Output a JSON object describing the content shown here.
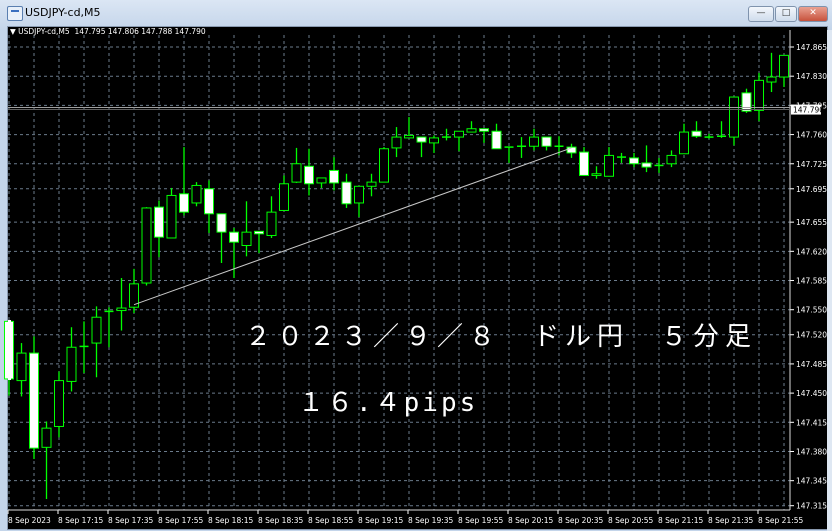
{
  "window": {
    "title": "USDJPY-cd,M5",
    "buttons": {
      "minimize": "—",
      "maximize": "□",
      "close": "✕"
    }
  },
  "chart_header": {
    "symbol": "USDJPY-cd,M5",
    "ohlc_text": "147.795 147.806 147.788 147.790"
  },
  "annotations": {
    "title_text": "２０２３／９／８　ドル円　５分足",
    "pips_text": "１６.４pips"
  },
  "chart_data": {
    "type": "candlestick",
    "symbol": "USDJPY-cd",
    "timeframe": "M5",
    "ylim": [
      147.315,
      147.87
    ],
    "grid": true,
    "colors": {
      "bull_outline": "#00ff00",
      "bull_fill": "#000000",
      "bear_fill": "#ffffff",
      "wick": "#00ff00",
      "grid": "#6b7b8c",
      "background": "#000000",
      "trendline": "#c8c8c8",
      "bid_line": "#a0a0a0"
    },
    "bid_price": "147.790",
    "y_ticks": [
      "147.865",
      "147.830",
      "147.795",
      "147.760",
      "147.725",
      "147.695",
      "147.655",
      "147.620",
      "147.585",
      "147.550",
      "147.520",
      "147.485",
      "147.450",
      "147.415",
      "147.380",
      "147.345",
      "147.315"
    ],
    "x_ticks": [
      "8 Sep 2023",
      "8 Sep 17:15",
      "8 Sep 17:35",
      "8 Sep 17:55",
      "8 Sep 18:15",
      "8 Sep 18:35",
      "8 Sep 18:55",
      "8 Sep 19:15",
      "8 Sep 19:35",
      "8 Sep 19:55",
      "8 Sep 20:15",
      "8 Sep 20:35",
      "8 Sep 20:55",
      "8 Sep 21:15",
      "8 Sep 21:35",
      "8 Sep 21:55"
    ],
    "trendline": {
      "from": {
        "time": "17:45",
        "price": 147.556
      },
      "to": {
        "time": "20:40",
        "price": 147.744
      }
    },
    "candles": [
      {
        "t": "16:55",
        "o": 147.536,
        "h": 147.537,
        "l": 147.447,
        "c": 147.467
      },
      {
        "t": "17:00",
        "o": 147.465,
        "h": 147.51,
        "l": 147.446,
        "c": 147.498
      },
      {
        "t": "17:05",
        "o": 147.498,
        "h": 147.518,
        "l": 147.371,
        "c": 147.384
      },
      {
        "t": "17:10",
        "o": 147.385,
        "h": 147.416,
        "l": 147.323,
        "c": 147.408
      },
      {
        "t": "17:15",
        "o": 147.41,
        "h": 147.476,
        "l": 147.397,
        "c": 147.465
      },
      {
        "t": "17:20",
        "o": 147.464,
        "h": 147.529,
        "l": 147.452,
        "c": 147.505
      },
      {
        "t": "17:25",
        "o": 147.506,
        "h": 147.536,
        "l": 147.474,
        "c": 147.506
      },
      {
        "t": "17:30",
        "o": 147.51,
        "h": 147.554,
        "l": 147.469,
        "c": 147.541
      },
      {
        "t": "17:35",
        "o": 147.548,
        "h": 147.553,
        "l": 147.505,
        "c": 147.548
      },
      {
        "t": "17:40",
        "o": 147.549,
        "h": 147.588,
        "l": 147.525,
        "c": 147.552
      },
      {
        "t": "17:45",
        "o": 147.553,
        "h": 147.599,
        "l": 147.546,
        "c": 147.581
      },
      {
        "t": "17:50",
        "o": 147.582,
        "h": 147.673,
        "l": 147.579,
        "c": 147.672
      },
      {
        "t": "17:55",
        "o": 147.673,
        "h": 147.681,
        "l": 147.613,
        "c": 147.637
      },
      {
        "t": "18:00",
        "o": 147.636,
        "h": 147.696,
        "l": 147.636,
        "c": 147.687
      },
      {
        "t": "18:05",
        "o": 147.689,
        "h": 147.745,
        "l": 147.663,
        "c": 147.667
      },
      {
        "t": "18:10",
        "o": 147.678,
        "h": 147.703,
        "l": 147.674,
        "c": 147.699
      },
      {
        "t": "18:15",
        "o": 147.695,
        "h": 147.705,
        "l": 147.642,
        "c": 147.665
      },
      {
        "t": "18:20",
        "o": 147.665,
        "h": 147.665,
        "l": 147.606,
        "c": 147.643
      },
      {
        "t": "18:25",
        "o": 147.643,
        "h": 147.648,
        "l": 147.588,
        "c": 147.631
      },
      {
        "t": "18:30",
        "o": 147.627,
        "h": 147.68,
        "l": 147.614,
        "c": 147.643
      },
      {
        "t": "18:35",
        "o": 147.644,
        "h": 147.644,
        "l": 147.618,
        "c": 147.641
      },
      {
        "t": "18:40",
        "o": 147.639,
        "h": 147.686,
        "l": 147.636,
        "c": 147.667
      },
      {
        "t": "18:45",
        "o": 147.669,
        "h": 147.711,
        "l": 147.669,
        "c": 147.701
      },
      {
        "t": "18:50",
        "o": 147.703,
        "h": 147.744,
        "l": 147.702,
        "c": 147.725
      },
      {
        "t": "18:55",
        "o": 147.722,
        "h": 147.743,
        "l": 147.687,
        "c": 147.701
      },
      {
        "t": "19:00",
        "o": 147.702,
        "h": 147.708,
        "l": 147.696,
        "c": 147.708
      },
      {
        "t": "19:05",
        "o": 147.717,
        "h": 147.733,
        "l": 147.693,
        "c": 147.702
      },
      {
        "t": "19:10",
        "o": 147.703,
        "h": 147.713,
        "l": 147.672,
        "c": 147.677
      },
      {
        "t": "19:15",
        "o": 147.678,
        "h": 147.698,
        "l": 147.661,
        "c": 147.698
      },
      {
        "t": "19:20",
        "o": 147.698,
        "h": 147.713,
        "l": 147.686,
        "c": 147.703
      },
      {
        "t": "19:25",
        "o": 147.703,
        "h": 147.745,
        "l": 147.703,
        "c": 147.743
      },
      {
        "t": "19:30",
        "o": 147.744,
        "h": 147.769,
        "l": 147.733,
        "c": 147.757
      },
      {
        "t": "19:35",
        "o": 147.756,
        "h": 147.781,
        "l": 147.756,
        "c": 147.759
      },
      {
        "t": "19:40",
        "o": 147.757,
        "h": 147.757,
        "l": 147.733,
        "c": 147.751
      },
      {
        "t": "19:45",
        "o": 147.75,
        "h": 147.759,
        "l": 147.738,
        "c": 147.756
      },
      {
        "t": "19:50",
        "o": 147.756,
        "h": 147.767,
        "l": 147.753,
        "c": 147.757
      },
      {
        "t": "19:55",
        "o": 147.757,
        "h": 147.764,
        "l": 147.74,
        "c": 147.764
      },
      {
        "t": "20:00",
        "o": 147.763,
        "h": 147.776,
        "l": 147.763,
        "c": 147.767
      },
      {
        "t": "20:05",
        "o": 147.767,
        "h": 147.767,
        "l": 147.75,
        "c": 147.764
      },
      {
        "t": "20:10",
        "o": 147.764,
        "h": 147.773,
        "l": 147.743,
        "c": 147.743
      },
      {
        "t": "20:15",
        "o": 147.745,
        "h": 147.745,
        "l": 147.726,
        "c": 147.745
      },
      {
        "t": "20:20",
        "o": 147.746,
        "h": 147.757,
        "l": 147.732,
        "c": 147.746
      },
      {
        "t": "20:25",
        "o": 147.746,
        "h": 147.767,
        "l": 147.741,
        "c": 147.757
      },
      {
        "t": "20:30",
        "o": 147.757,
        "h": 147.757,
        "l": 147.741,
        "c": 147.746
      },
      {
        "t": "20:35",
        "o": 147.746,
        "h": 147.758,
        "l": 147.735,
        "c": 147.746
      },
      {
        "t": "20:40",
        "o": 147.745,
        "h": 147.749,
        "l": 147.732,
        "c": 147.738
      },
      {
        "t": "20:45",
        "o": 147.739,
        "h": 147.745,
        "l": 147.711,
        "c": 147.711
      },
      {
        "t": "20:50",
        "o": 147.711,
        "h": 147.722,
        "l": 147.707,
        "c": 147.713
      },
      {
        "t": "20:55",
        "o": 147.71,
        "h": 147.745,
        "l": 147.71,
        "c": 147.735
      },
      {
        "t": "21:00",
        "o": 147.733,
        "h": 147.738,
        "l": 147.726,
        "c": 147.733
      },
      {
        "t": "21:05",
        "o": 147.732,
        "h": 147.738,
        "l": 147.721,
        "c": 147.725
      },
      {
        "t": "21:10",
        "o": 147.726,
        "h": 147.747,
        "l": 147.715,
        "c": 147.721
      },
      {
        "t": "21:15",
        "o": 147.723,
        "h": 147.732,
        "l": 147.714,
        "c": 147.723
      },
      {
        "t": "21:20",
        "o": 147.725,
        "h": 147.741,
        "l": 147.721,
        "c": 147.735
      },
      {
        "t": "21:25",
        "o": 147.737,
        "h": 147.773,
        "l": 147.737,
        "c": 147.763
      },
      {
        "t": "21:30",
        "o": 147.764,
        "h": 147.776,
        "l": 147.756,
        "c": 147.758
      },
      {
        "t": "21:35",
        "o": 147.757,
        "h": 147.761,
        "l": 147.755,
        "c": 147.757
      },
      {
        "t": "21:40",
        "o": 147.758,
        "h": 147.776,
        "l": 147.756,
        "c": 147.758
      },
      {
        "t": "21:45",
        "o": 147.757,
        "h": 147.805,
        "l": 147.747,
        "c": 147.805
      },
      {
        "t": "21:50",
        "o": 147.81,
        "h": 147.815,
        "l": 147.786,
        "c": 147.788
      },
      {
        "t": "21:55",
        "o": 147.789,
        "h": 147.834,
        "l": 147.776,
        "c": 147.825
      },
      {
        "t": "22:00",
        "o": 147.823,
        "h": 147.858,
        "l": 147.811,
        "c": 147.829
      },
      {
        "t": "22:05",
        "o": 147.829,
        "h": 147.855,
        "l": 147.817,
        "c": 147.855
      }
    ]
  }
}
